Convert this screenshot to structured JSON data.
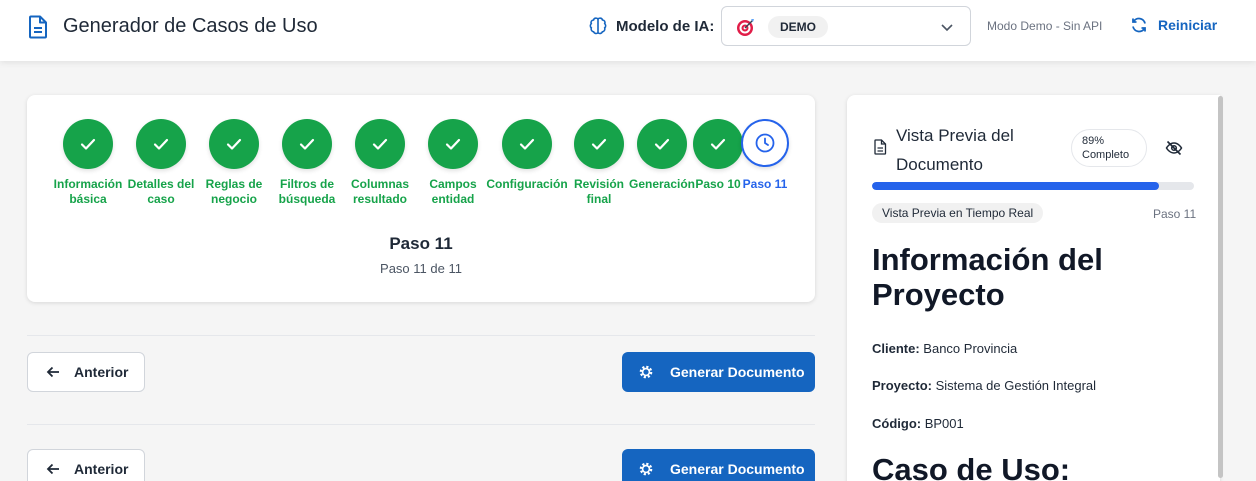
{
  "header": {
    "app_title": "Generador de Casos de Uso",
    "app_icon": "document-icon",
    "model_label": "Modelo de IA:",
    "model_value": "DEMO",
    "mode_text": "Modo Demo - Sin API",
    "restart_label": "Reiniciar"
  },
  "steps": {
    "items": [
      {
        "label": "Información\nbásica",
        "status": "done"
      },
      {
        "label": "Detalles del\ncaso",
        "status": "done"
      },
      {
        "label": "Reglas de\nnegocio",
        "status": "done"
      },
      {
        "label": "Filtros de\nbúsqueda",
        "status": "done"
      },
      {
        "label": "Columnas\nresultado",
        "status": "done"
      },
      {
        "label": "Campos\nentidad",
        "status": "done"
      },
      {
        "label": "Configuración",
        "status": "done"
      },
      {
        "label": "Revisión\nfinal",
        "status": "done"
      },
      {
        "label": "Generación",
        "status": "done"
      },
      {
        "label": "Paso 10",
        "status": "done"
      },
      {
        "label": "Paso 11",
        "status": "current"
      }
    ],
    "current_title": "Paso 11",
    "current_sub": "Paso 11 de 11"
  },
  "nav": {
    "prev_label": "Anterior",
    "generate_label": "Generar Documento"
  },
  "preview": {
    "title": "Vista Previa del Documento",
    "percent_label": "89%",
    "complete_label": "Completo",
    "progress": 0.89,
    "chip": "Vista Previa en Tiempo Real",
    "step": "Paso 11",
    "heading": "Información del Proyecto",
    "fields": [
      {
        "key": "Cliente:",
        "value": "Banco Provincia"
      },
      {
        "key": "Proyecto:",
        "value": "Sistema de Gestión Integral"
      },
      {
        "key": "Código:",
        "value": "BP001"
      }
    ],
    "heading2": "Caso de Uso:"
  },
  "colors": {
    "done": "#16a34a",
    "current": "#2563eb",
    "primary_button": "#1565c0"
  }
}
